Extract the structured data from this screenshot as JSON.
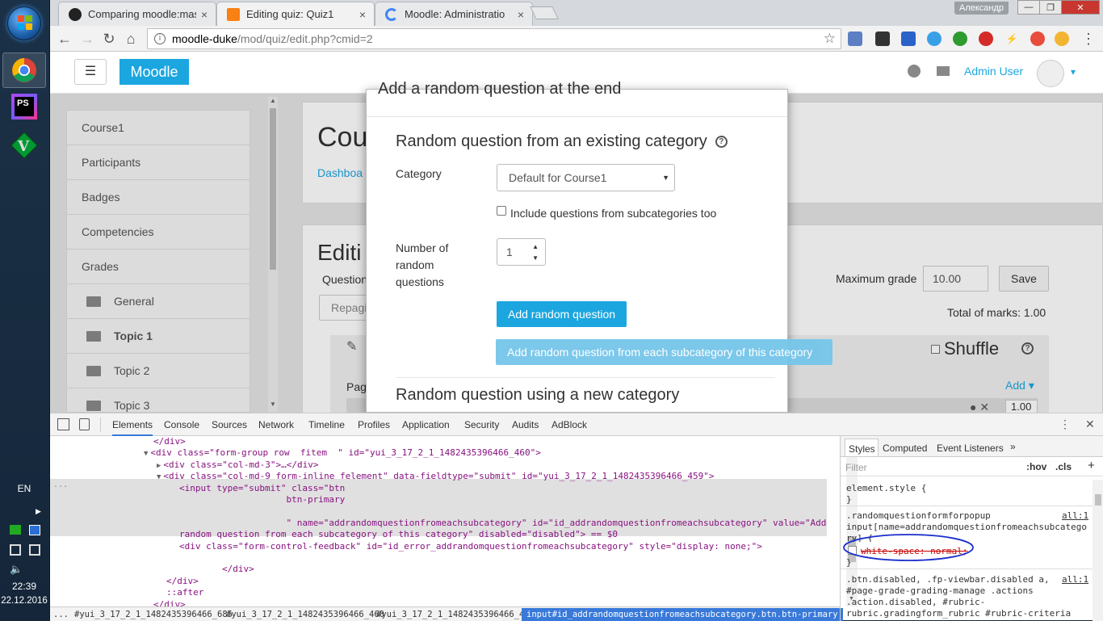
{
  "taskbar": {
    "lang": "EN",
    "time": "22:39",
    "date": "22.12.2016",
    "apps": [
      "chrome-icon",
      "phpstorm-icon",
      "vim-icon"
    ],
    "phpstorm_label": "PS"
  },
  "window": {
    "user_chip": "Александр",
    "min": "—",
    "max": "❐",
    "close": "✕"
  },
  "tabs": [
    {
      "title": "Comparing moodle:mast",
      "close": "×"
    },
    {
      "title": "Editing quiz: Quiz1",
      "close": "×"
    },
    {
      "title": "Moodle: Administratio",
      "close": "×"
    }
  ],
  "address": {
    "host": "moodle-duke",
    "path": "/mod/quiz/edit.php?cmid=2",
    "info": "i",
    "star": "☆"
  },
  "nav": {
    "back": "←",
    "forward": "→",
    "reload": "↻",
    "home": "⌂"
  },
  "moodle": {
    "menu": "☰",
    "brand": "Moodle",
    "user": "Admin User",
    "caret": "▾",
    "drawer": [
      {
        "label": "Course1",
        "indent": false,
        "bold": false
      },
      {
        "label": "Participants",
        "indent": false,
        "bold": false
      },
      {
        "label": "Badges",
        "indent": false,
        "bold": false
      },
      {
        "label": "Competencies",
        "indent": false,
        "bold": false
      },
      {
        "label": "Grades",
        "indent": false,
        "bold": false
      },
      {
        "label": "General",
        "indent": true,
        "bold": false
      },
      {
        "label": "Topic 1",
        "indent": true,
        "bold": true
      },
      {
        "label": "Topic 2",
        "indent": true,
        "bold": false
      },
      {
        "label": "Topic 3",
        "indent": true,
        "bold": false
      }
    ],
    "course_title": "Cou",
    "breadcrumb": "Dashboa",
    "editing_title": "Editi",
    "question_label": "Question",
    "repaginate": "Repagi",
    "max_grade_label": "Maximum grade",
    "max_grade_value": "10.00",
    "save": "Save",
    "total_marks": "Total of marks: 1.00",
    "shuffle": "Shuffle",
    "page_label": "Pag",
    "add": "Add",
    "mark_value": "1.00"
  },
  "modal": {
    "title": "Add a random question at the end",
    "section1": "Random question from an existing category",
    "help": "?",
    "category_label": "Category",
    "category_value": "Default for Course1",
    "include_sub": "Include questions from subcategories too",
    "number_label_1": "Number of",
    "number_label_2": "random",
    "number_label_3": "questions",
    "number_value": "1",
    "add_random": "Add random question",
    "add_each_sub": "Add random question from each subcategory of this category",
    "section2": "Random question using a new category"
  },
  "devtools": {
    "tabs": [
      "Elements",
      "Console",
      "Sources",
      "Network",
      "Timeline",
      "Profiles",
      "Application",
      "Security",
      "Audits",
      "AdBlock"
    ],
    "lines": [
      {
        "indent": 14,
        "arrow": "",
        "html": "</div>"
      },
      {
        "indent": 14,
        "arrow": "▼",
        "html": "<div class=\"form-group row  fitem  \" id=\"yui_3_17_2_1_1482435396466_460\">"
      },
      {
        "indent": 16,
        "arrow": "▶",
        "html": "<div class=\"col-md-3\">…</div>"
      },
      {
        "indent": 16,
        "arrow": "▼",
        "html": "<div class=\"col-md-9 form-inline felement\" data-fieldtype=\"submit\" id=\"yui_3_17_2_1_1482435396466_459\">"
      },
      {
        "indent": 18,
        "arrow": "",
        "html": "<input type=\"submit\" class=\"btn"
      },
      {
        "indent": 18,
        "arrow": "",
        "html": "                    btn-primary"
      },
      {
        "indent": 18,
        "arrow": "",
        "html": ""
      },
      {
        "indent": 18,
        "arrow": "",
        "html": "                    \" name=\"addrandomquestionfromeachsubcategory\" id=\"id_addrandomquestionfromeachsubcategory\" value=\"Add"
      },
      {
        "indent": 18,
        "arrow": "",
        "html": "random question from each subcategory of this category\" disabled=\"disabled\"> == $0"
      },
      {
        "indent": 18,
        "arrow": "",
        "html": "<div class=\"form-control-feedback\" id=\"id_error_addrandomquestionfromeachsubcategory\" style=\"display: none;\">"
      },
      {
        "indent": 18,
        "arrow": "",
        "html": ""
      },
      {
        "indent": 18,
        "arrow": "",
        "html": "        </div>"
      },
      {
        "indent": 16,
        "arrow": "",
        "html": "</div>"
      },
      {
        "indent": 16,
        "arrow": "",
        "html": "::after"
      },
      {
        "indent": 14,
        "arrow": "",
        "html": "</div>"
      }
    ],
    "ellipsis": "...",
    "crumbs": [
      "#yui_3_17_2_1_1482435396466_685",
      "#yui_3_17_2_1_1482435396466_460",
      "#yui_3_17_2_1_1482435396466_459",
      "input#id_addrandomquestionfromeachsubcategory.btn.btn-primary"
    ],
    "styles_tabs": [
      "Styles",
      "Computed",
      "Event Listeners",
      "»"
    ],
    "filter": "Filter",
    "hov": ":hov",
    "cls": ".cls",
    "plus": "+",
    "element_style": "element.style {",
    "brace_close": "}",
    "rule1_sel1": ".randomquestionformforpopup",
    "rule1_sel2": "input[name=addrandomquestionfromeachsubcatego",
    "rule1_sel3": "ry] {",
    "rule1_src": "all:1",
    "rule1_prop": "white-space: normal;",
    "rule2_sel1": ".btn.disabled, .fp-viewbar.disabled a,",
    "rule2_sel2": "#page-grade-grading-manage .actions",
    "rule2_sel3": ".action.disabled, #rubric-",
    "rule2_sel4": "rubric.gradingform_rubric #rubric-criteria",
    "rule2_src": "all:1",
    "close": "✕",
    "menu": "⋮"
  },
  "colors": {
    "moodle_blue": "#1ba6e0",
    "annotation": "#1a2ecc"
  }
}
